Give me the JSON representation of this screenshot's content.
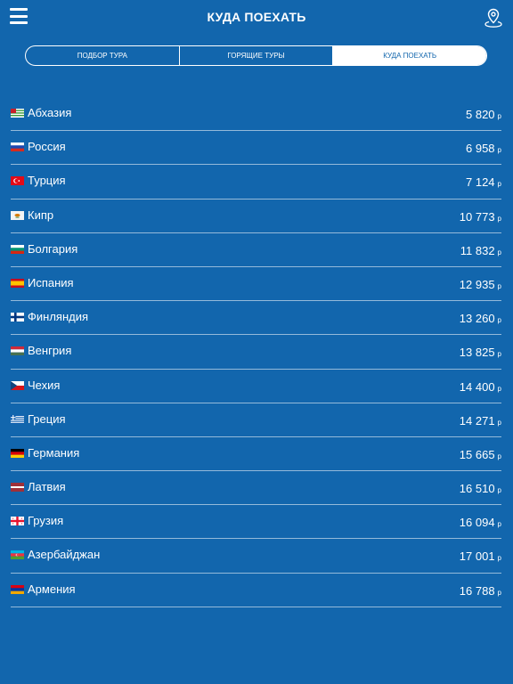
{
  "header": {
    "title": "КУДА ПОЕХАТЬ",
    "menu_icon": "hamburger-menu-icon",
    "location_icon": "map-pin-icon"
  },
  "tabs": [
    {
      "label": "ПОДБОР ТУРА",
      "active": false
    },
    {
      "label": "ГОРЯЩИЕ ТУРЫ",
      "active": false
    },
    {
      "label": "КУДА ПОЕХАТЬ",
      "active": true
    }
  ],
  "currency": "р",
  "colors": {
    "background": "#1266ad",
    "text": "#ffffff"
  },
  "destinations": [
    {
      "name": "Абхазия",
      "price": "5 820",
      "flag": "abkhazia-flag-icon"
    },
    {
      "name": "Россия",
      "price": "6 958",
      "flag": "russia-flag-icon"
    },
    {
      "name": "Турция",
      "price": "7 124",
      "flag": "turkey-flag-icon"
    },
    {
      "name": "Кипр",
      "price": "10 773",
      "flag": "cyprus-flag-icon"
    },
    {
      "name": "Болгария",
      "price": "11 832",
      "flag": "bulgaria-flag-icon"
    },
    {
      "name": "Испания",
      "price": "12 935",
      "flag": "spain-flag-icon"
    },
    {
      "name": "Финляндия",
      "price": "13 260",
      "flag": "finland-flag-icon"
    },
    {
      "name": "Венгрия",
      "price": "13 825",
      "flag": "hungary-flag-icon"
    },
    {
      "name": "Чехия",
      "price": "14 400",
      "flag": "czech-flag-icon"
    },
    {
      "name": "Греция",
      "price": "14 271",
      "flag": "greece-flag-icon"
    },
    {
      "name": "Германия",
      "price": "15 665",
      "flag": "germany-flag-icon"
    },
    {
      "name": "Латвия",
      "price": "16 510",
      "flag": "latvia-flag-icon"
    },
    {
      "name": "Грузия",
      "price": "16 094",
      "flag": "georgia-flag-icon"
    },
    {
      "name": "Азербайджан",
      "price": "17 001",
      "flag": "azerbaijan-flag-icon"
    },
    {
      "name": "Армения",
      "price": "16 788",
      "flag": "armenia-flag-icon"
    }
  ]
}
